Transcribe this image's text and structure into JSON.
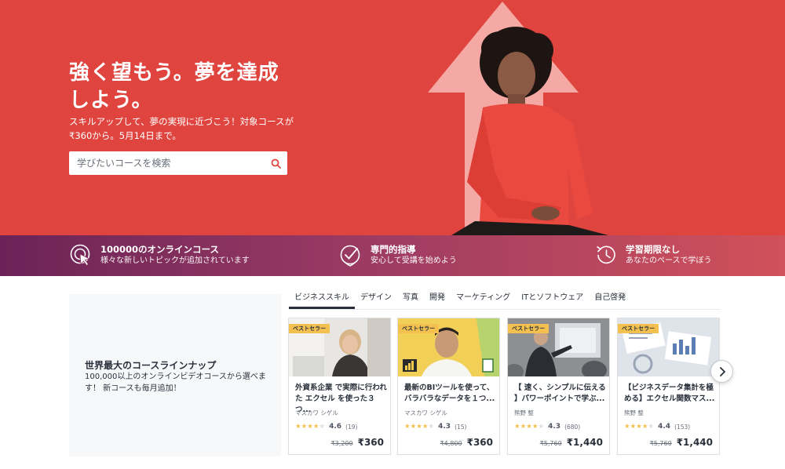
{
  "hero": {
    "title": "強く望もう。夢を達成しよう。",
    "subtitle": "スキルアップして、夢の実現に近づこう！対象コースが₹360から。5月14日まで。",
    "search_placeholder": "学びたいコースを検索",
    "colors": {
      "background": "#e0443f",
      "arrow": "#f5a9a4"
    }
  },
  "features": [
    {
      "icon": "course-cursor-icon",
      "title": "100000のオンラインコース",
      "desc": "様々な新しいトピックが追加されています"
    },
    {
      "icon": "check-badge-icon",
      "title": "専門的指導",
      "desc": "安心して受講を始めよう"
    },
    {
      "icon": "history-clock-icon",
      "title": "学習期限なし",
      "desc": "あなたのペースで学ぼう"
    }
  ],
  "promo": {
    "title": "世界最大のコースラインナップ",
    "desc": "100,000以上のオンラインビデオコースから選べます！ 新コースも毎月追加！"
  },
  "tabs": [
    "ビジネススキル",
    "デザイン",
    "写真",
    "開発",
    "マーケティング",
    "ITとソフトウェア",
    "自己啓発"
  ],
  "active_tab": 0,
  "cards": [
    {
      "badge": "ベストセラー",
      "title": "外資系企業 で実際に行われ た エクセル を使った３つ...",
      "author": "マスカワ シゲル",
      "rating": "4.6",
      "count": "(19)",
      "stars": 4.5,
      "old_price": "₹3,200",
      "price": "₹360"
    },
    {
      "badge": "ベストセラー",
      "title": "最新のBIツールを使って、バラバラなデータを１つ...",
      "author": "マスカワ シゲル",
      "rating": "4.3",
      "count": "(15)",
      "stars": 4,
      "old_price": "₹4,800",
      "price": "₹360"
    },
    {
      "badge": "ベストセラー",
      "title": "【 速く、シンプルに伝える 】パワーポイントで学ぶ...",
      "author": "熊野 整",
      "rating": "4.3",
      "count": "(680)",
      "stars": 4,
      "old_price": "₹5,760",
      "price": "₹1,440"
    },
    {
      "badge": "ベストセラー",
      "title": "【ビジネスデータ集計を極める】エクセル関数マス...",
      "author": "熊野 整",
      "rating": "4.4",
      "count": "(153)",
      "stars": 4.5,
      "old_price": "₹5,760",
      "price": "₹1,440"
    }
  ]
}
